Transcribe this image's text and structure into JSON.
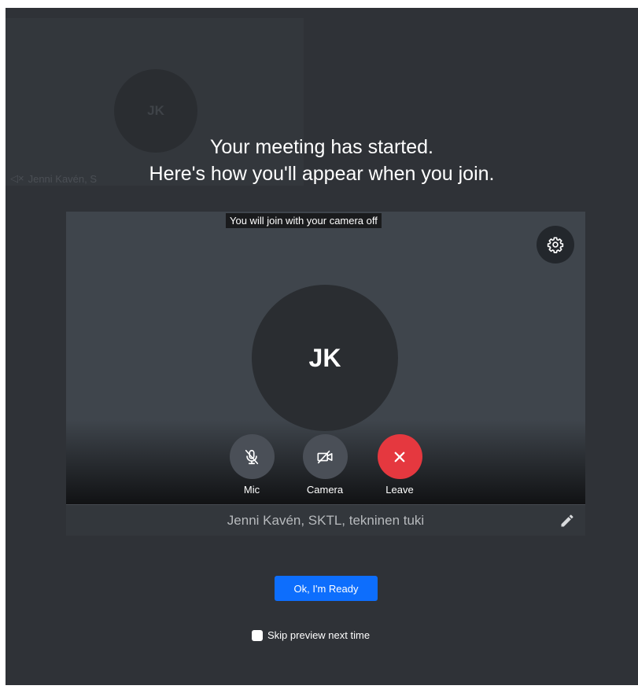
{
  "background": {
    "tile_initials": "JK",
    "tile_name": "Jenni Kavén, S"
  },
  "overlay": {
    "line1": "Your meeting has started.",
    "line2": "Here's how you'll appear when you join."
  },
  "preview": {
    "camera_note": "You will join with your camera off",
    "initials": "JK",
    "display_name": "Jenni Kavén, SKTL, tekninen tuki"
  },
  "controls": {
    "mic_label": "Mic",
    "camera_label": "Camera",
    "leave_label": "Leave"
  },
  "actions": {
    "ready_label": "Ok, I'm Ready",
    "skip_label": "Skip preview next time"
  },
  "colors": {
    "stage_bg": "#2f3237",
    "button_grey": "#4a4f57",
    "leave_red": "#e5383f",
    "primary_blue": "#0d6efd"
  },
  "icons": {
    "mic": "mic-off-icon",
    "camera": "camera-off-icon",
    "leave": "close-icon",
    "settings": "gear-icon",
    "edit": "pencil-icon",
    "bg_mute": "speaker-mute-icon"
  }
}
